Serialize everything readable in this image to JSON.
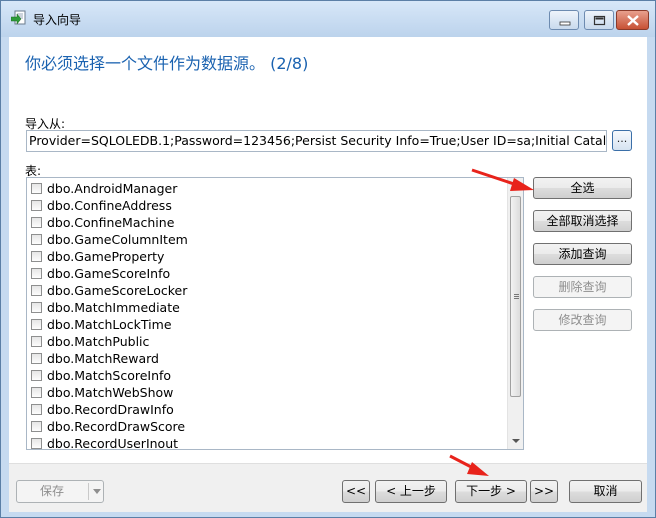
{
  "window": {
    "title": "导入向导",
    "accent_color": "#1a62b0",
    "titlebar_icons": [
      "minimize-icon",
      "maximize-icon",
      "close-icon"
    ]
  },
  "heading": "你必须选择一个文件作为数据源。 (2/8)",
  "import_from": {
    "label": "导入从:",
    "value": "Provider=SQLOLEDB.1;Password=123456;Persist Security Info=True;User ID=sa;Initial Catalog=QPC",
    "browse_label": "..."
  },
  "tables": {
    "label": "表:",
    "items": [
      {
        "name": "dbo.AndroidManager",
        "checked": false
      },
      {
        "name": "dbo.ConfineAddress",
        "checked": false
      },
      {
        "name": "dbo.ConfineMachine",
        "checked": false
      },
      {
        "name": "dbo.GameColumnItem",
        "checked": false
      },
      {
        "name": "dbo.GameProperty",
        "checked": false
      },
      {
        "name": "dbo.GameScoreInfo",
        "checked": false
      },
      {
        "name": "dbo.GameScoreLocker",
        "checked": false
      },
      {
        "name": "dbo.MatchImmediate",
        "checked": false
      },
      {
        "name": "dbo.MatchLockTime",
        "checked": false
      },
      {
        "name": "dbo.MatchPublic",
        "checked": false
      },
      {
        "name": "dbo.MatchReward",
        "checked": false
      },
      {
        "name": "dbo.MatchScoreInfo",
        "checked": false
      },
      {
        "name": "dbo.MatchWebShow",
        "checked": false
      },
      {
        "name": "dbo.RecordDrawInfo",
        "checked": false
      },
      {
        "name": "dbo.RecordDrawScore",
        "checked": false
      },
      {
        "name": "dbo.RecordUserInout",
        "checked": false
      }
    ]
  },
  "side_buttons": {
    "select_all": "全选",
    "deselect_all": "全部取消选择",
    "add_query": "添加查询",
    "delete_query": "删除查询",
    "edit_query": "修改查询"
  },
  "footer": {
    "save": "保存",
    "first": "<<",
    "prev": "< 上一步",
    "next": "下一步 >",
    "last": ">>",
    "cancel": "取消"
  },
  "annotation_color": "#e8231b"
}
